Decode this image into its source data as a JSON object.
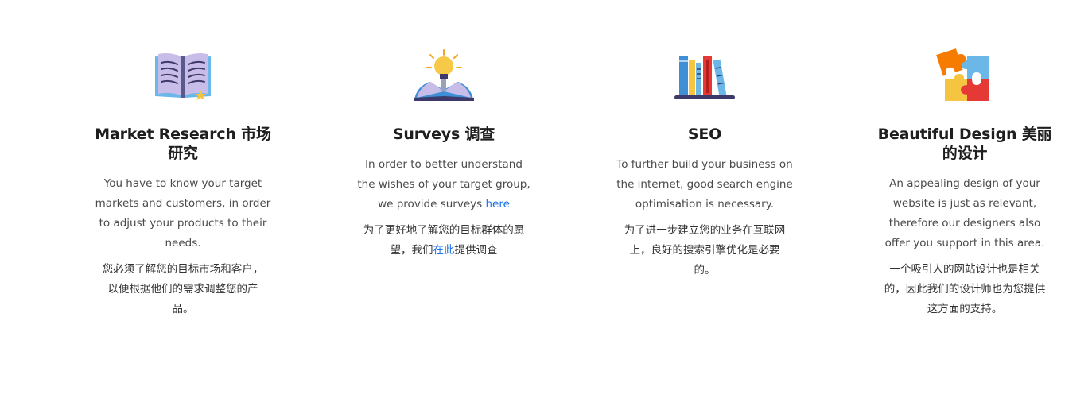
{
  "features": [
    {
      "icon": "open-book-icon",
      "title": "Market Research 市场研究",
      "body_en": "You have to know your target markets and customers, in order to adjust your products to their needs.",
      "body_zh": "您必须了解您的目标市场和客户，以便根据他们的需求调整您的产品。"
    },
    {
      "icon": "idea-book-icon",
      "title": "Surveys 调查",
      "body_en_prefix": "In order to better understand the wishes of your target group, we provide surveys ",
      "body_en_link": "here",
      "body_zh_prefix": "为了更好地了解您的目标群体的愿望，我们",
      "body_zh_link": "在此",
      "body_zh_suffix": "提供调查"
    },
    {
      "icon": "bookshelf-icon",
      "title": "SEO",
      "body_en": "To further build your business on the internet, good search engine optimisation is necessary.",
      "body_zh": "为了进一步建立您的业务在互联网上，良好的搜索引擎优化是必要的。"
    },
    {
      "icon": "puzzle-icon",
      "title": "Beautiful Design 美丽的设计",
      "body_en": "An appealing design of your website is just as relevant, therefore our designers also offer you support in this area.",
      "body_zh": "一个吸引人的网站设计也是相关的，因此我们的设计师也为您提供这方面的支持。"
    }
  ],
  "colors": {
    "link": "#1a73e8",
    "heading": "#1f1f1f",
    "body": "#4a4a4a"
  }
}
